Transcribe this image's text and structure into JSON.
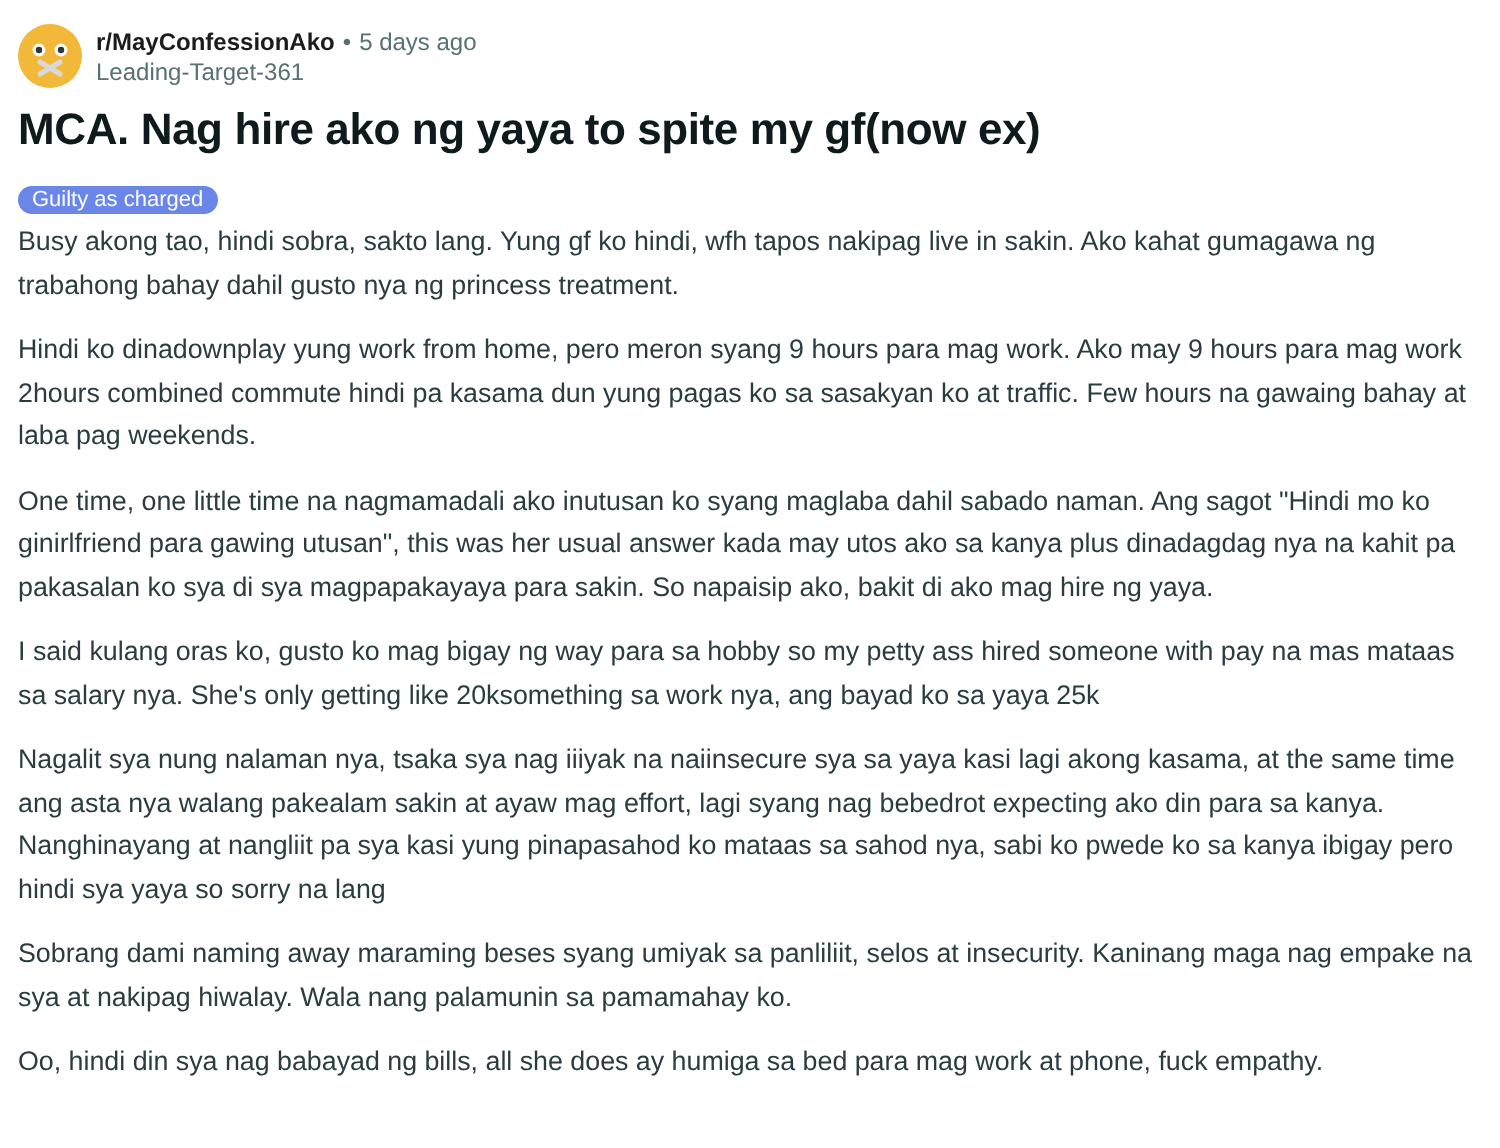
{
  "post": {
    "subreddit": "r/MayConfessionAko",
    "separator": "•",
    "time": "5 days ago",
    "author": "Leading-Target-361",
    "title": "MCA. Nag hire ako ng yaya to spite my gf(now ex)",
    "flair": "Guilty as charged",
    "paragraphs": [
      "Busy akong tao, hindi sobra, sakto lang. Yung gf ko hindi, wfh tapos nakipag live in sakin. Ako kahat gumagawa ng trabahong bahay dahil gusto nya ng princess treatment.",
      "Hindi ko dinadownplay yung work from home, pero meron syang 9 hours para mag work. Ako may 9 hours para mag work 2hours combined commute hindi pa kasama dun yung pagas ko sa sasakyan ko at traffic. Few hours na gawaing bahay at laba pag weekends.",
      "One time, one little time na nagmamadali ako inutusan ko syang maglaba dahil sabado naman. Ang sagot \"Hindi mo ko ginirlfriend para gawing utusan\", this was her usual answer kada may utos ako sa kanya plus dinadagdag nya na kahit pa pakasalan ko sya di sya magpapakayaya para sakin. So napaisip ako, bakit di ako mag hire ng yaya.",
      "I said kulang oras ko, gusto ko mag bigay ng way para sa hobby so my petty ass hired someone with pay na mas mataas sa salary nya. She's only getting like 20ksomething sa work nya, ang bayad ko sa yaya 25k",
      "Nagalit sya nung nalaman nya, tsaka sya nag iiiyak na naiinsecure sya sa yaya kasi lagi akong kasama, at the same time ang asta nya walang pakealam sakin at ayaw mag effort, lagi syang nag bebedrot expecting ako din para sa kanya. Nanghinayang at nangliit pa sya kasi yung pinapasahod ko mataas sa sahod nya, sabi ko pwede ko sa kanya ibigay pero hindi sya yaya so sorry na lang",
      "Sobrang dami naming away maraming beses syang umiyak sa panliliit, selos at insecurity. Kaninang maga nag empake na sya at nakipag hiwalay. Wala nang palamunin sa pamamahay ko.",
      "Oo, hindi din sya nag babayad ng bills, all she does ay humiga sa bed para mag work at phone, fuck empathy."
    ]
  }
}
